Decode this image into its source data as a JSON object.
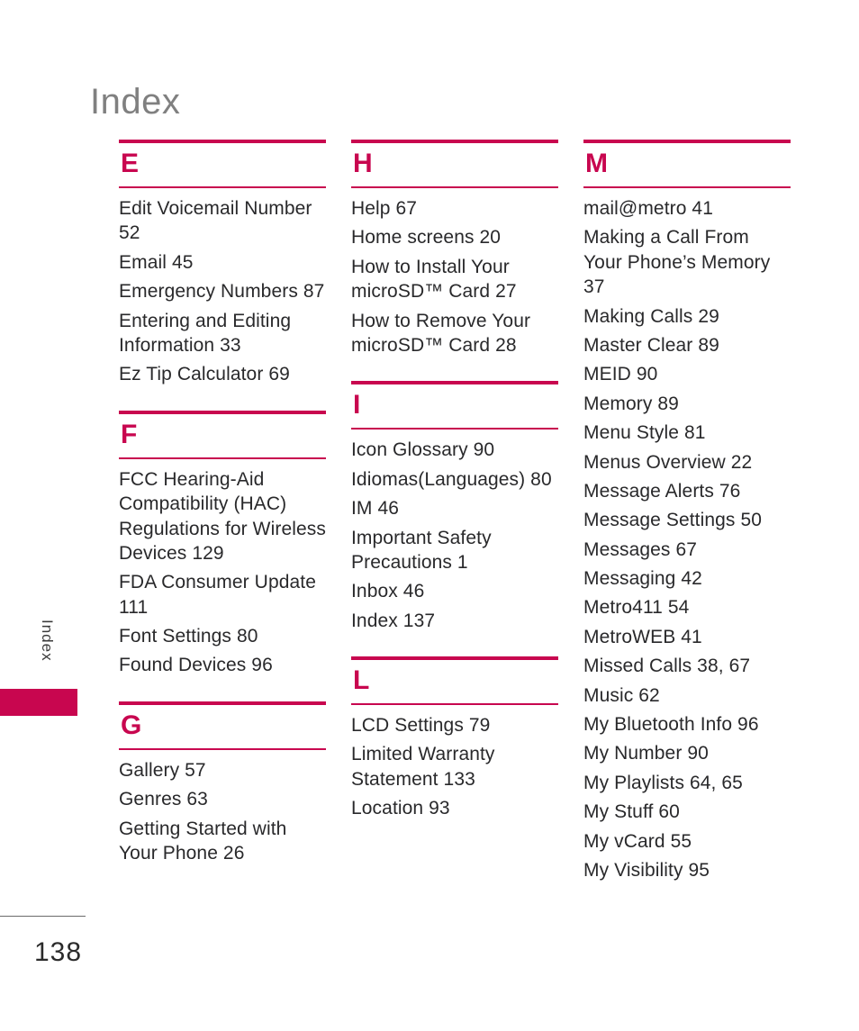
{
  "page": {
    "title": "Index",
    "side_tab_label": "Index",
    "page_number": "138",
    "accent_color": "#C8064F",
    "title_color": "#808080",
    "text_color": "#29292b"
  },
  "columns": [
    {
      "sections": [
        {
          "letter": "E",
          "entries": [
            "Edit Voicemail Number 52",
            "Email 45",
            "Emergency Numbers 87",
            "Entering and Editing Information 33",
            "Ez Tip Calculator 69"
          ]
        },
        {
          "letter": "F",
          "entries": [
            "FCC Hearing-Aid Compatibility (HAC) Regulations for Wireless Devices 129",
            "FDA Consumer Update 111",
            "Font Settings 80",
            "Found Devices 96"
          ]
        },
        {
          "letter": "G",
          "entries": [
            "Gallery 57",
            "Genres 63",
            "Getting Started with Your Phone 26"
          ]
        }
      ]
    },
    {
      "sections": [
        {
          "letter": "H",
          "entries": [
            "Help 67",
            "Home screens 20",
            "How to Install Your microSD™ Card 27",
            "How to Remove Your microSD™ Card 28"
          ]
        },
        {
          "letter": "I",
          "entries": [
            "Icon Glossary 90",
            "Idiomas(Languages) 80",
            "IM 46",
            "Important Safety Precautions 1",
            "Inbox 46",
            "Index 137"
          ]
        },
        {
          "letter": "L",
          "entries": [
            "LCD Settings 79",
            "Limited Warranty Statement 133",
            "Location 93"
          ]
        }
      ]
    },
    {
      "sections": [
        {
          "letter": "M",
          "entries": [
            "mail@metro 41",
            "Making a Call From Your Phone’s Memory 37",
            "Making Calls 29",
            "Master Clear 89",
            "MEID 90",
            "Memory 89",
            "Menu Style 81",
            "Menus Overview 22",
            "Message Alerts 76",
            "Message Settings 50",
            "Messages 67",
            "Messaging 42",
            "Metro411  54",
            "MetroWEB 41",
            "Missed Calls 38, 67",
            "Music 62",
            "My Bluetooth Info 96",
            "My Number 90",
            "My Playlists 64, 65",
            "My Stuff 60",
            "My vCard 55",
            "My Visibility 95"
          ]
        }
      ]
    }
  ]
}
